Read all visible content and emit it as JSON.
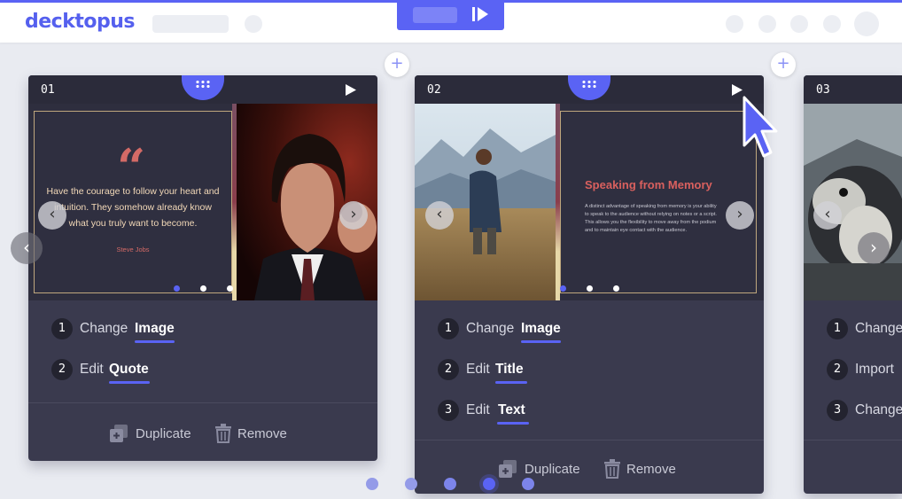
{
  "app": {
    "logo": "decktopus"
  },
  "toolbar": {
    "present_icon": "play-icon"
  },
  "insert_icon": "+",
  "cards": [
    {
      "number": "01",
      "quote": {
        "mark": "“",
        "lines": [
          "Have the courage to follow your heart and",
          "intuition. They somehow already know",
          "what you truly want to become."
        ],
        "author": "Steve Jobs"
      },
      "actions": [
        {
          "index": "1",
          "verb": "Change",
          "object": "Image"
        },
        {
          "index": "2",
          "verb": "Edit",
          "object": "Quote"
        }
      ],
      "duplicate_label": "Duplicate",
      "remove_label": "Remove"
    },
    {
      "number": "02",
      "slide": {
        "title": "Speaking from Memory",
        "body_lines": [
          "A distinct advantage of speaking from memory is your ability",
          "to speak to the audience without relying on notes or a script.",
          "This allows you the flexibility to move away from the podium",
          "and to maintain eye contact with the audience."
        ]
      },
      "actions": [
        {
          "index": "1",
          "verb": "Change",
          "object": "Image"
        },
        {
          "index": "2",
          "verb": "Edit",
          "object": "Title"
        },
        {
          "index": "3",
          "verb": "Edit",
          "object": "Text"
        }
      ],
      "duplicate_label": "Duplicate",
      "remove_label": "Remove"
    },
    {
      "number": "03",
      "actions": [
        {
          "index": "1",
          "verb": "Change"
        },
        {
          "index": "2",
          "verb": "Import"
        },
        {
          "index": "3",
          "verb": "Change"
        }
      ]
    }
  ],
  "colors": {
    "accent": "#5a63f4",
    "card_bg": "#3a3a4e",
    "quote_red": "#d36a66"
  }
}
